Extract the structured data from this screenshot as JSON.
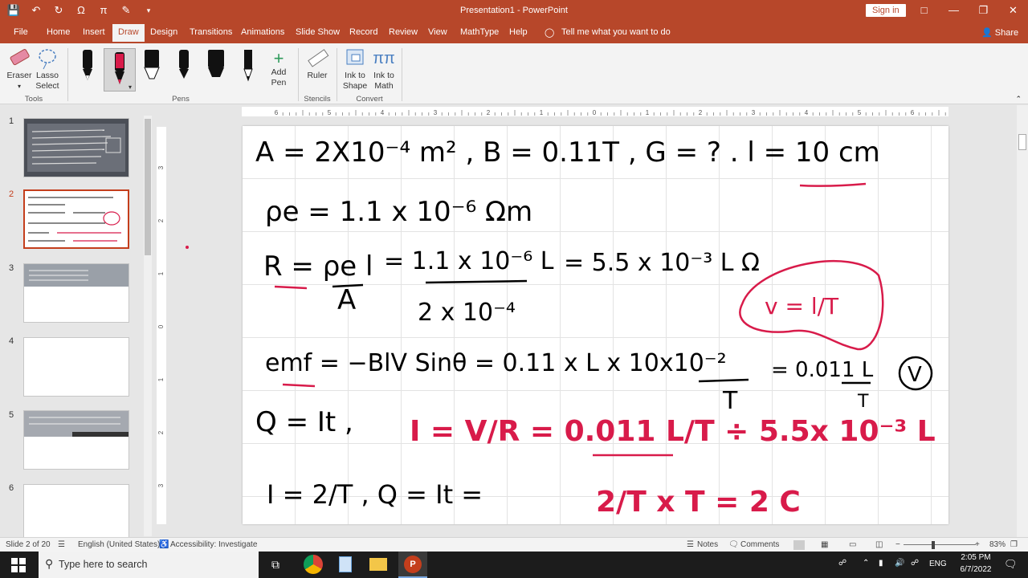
{
  "window": {
    "title": "Presentation1 - PowerPoint",
    "sign_in": "Sign in",
    "share": "Share"
  },
  "tabs": [
    "File",
    "Home",
    "Insert",
    "Draw",
    "Design",
    "Transitions",
    "Animations",
    "Slide Show",
    "Record",
    "Review",
    "View",
    "MathType",
    "Help"
  ],
  "active_tab": "Draw",
  "tell_me": "Tell me what you want to do",
  "ribbon": {
    "eraser": "Eraser",
    "lasso": "Lasso Select",
    "add_pen": "Add Pen",
    "ruler": "Ruler",
    "ink_to_shape": "Ink to Shape",
    "ink_to_math": "Ink to Math",
    "groups": {
      "tools": "Tools",
      "pens": "Pens",
      "stencils": "Stencils",
      "convert": "Convert"
    }
  },
  "thumbnails": [
    "1",
    "2",
    "3",
    "4",
    "5",
    "6"
  ],
  "selected_slide": "2",
  "ruler": {
    "h_ticks": [
      "6",
      "5",
      "4",
      "3",
      "2",
      "1",
      "0",
      "1",
      "2",
      "3",
      "4",
      "5",
      "6"
    ],
    "v_ticks": [
      "3",
      "2",
      "1",
      "0",
      "1",
      "2",
      "3"
    ]
  },
  "slide_ink": {
    "line1": "A = 2X10⁻⁴ m² ,  B = 0.11T ,  G = ? .  l = 10 cm",
    "line2": "ρe = 1.1 x 10⁻⁶ Ωm",
    "line3a": "R = ρe l",
    "line3b": "A",
    "line3c": "= 1.1 x 10⁻⁶ L",
    "line3d": "2 x 10⁻⁴",
    "line3e": "= 5.5 x 10⁻³ L Ω",
    "callout": "v = l/T",
    "line4": "emf = −BlV Sinθ = 0.11 x L x 10x10⁻²",
    "line4b": "T",
    "line4c": "= 0.011 L",
    "line4d": "T",
    "circled": "V",
    "line5": "Q = It ,",
    "line5red": "I = V/R = 0.011 L/T ÷ 5.5x 10⁻³ L",
    "line6": "I = 2/T ,  Q = It =",
    "line6red": "2/T x T = 2 C"
  },
  "status": {
    "slide_of": "Slide 2 of 20",
    "language": "English (United States)",
    "accessibility": "Accessibility: Investigate",
    "notes": "Notes",
    "comments": "Comments",
    "zoom": "83%"
  },
  "taskbar": {
    "search_placeholder": "Type here to search",
    "lang": "ENG",
    "time": "2:05 PM",
    "date": "6/7/2022"
  },
  "colors": {
    "accent": "#b7472a",
    "ink_red": "#d81b4a",
    "ink_black": "#000000"
  }
}
